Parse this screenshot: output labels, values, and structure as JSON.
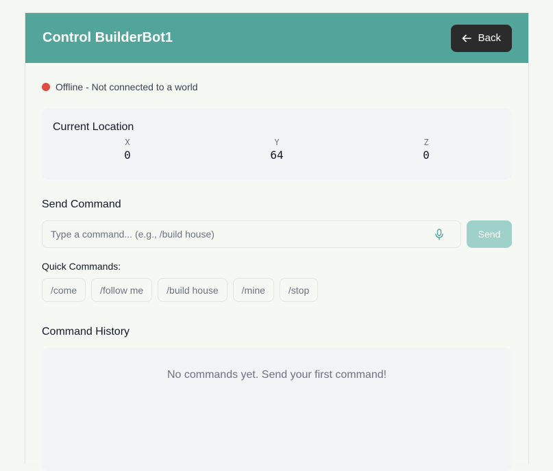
{
  "header": {
    "title": "Control BuilderBot1",
    "back_label": "Back"
  },
  "status": {
    "text": "Offline - Not connected to a world",
    "color": "#e04e41"
  },
  "location": {
    "title": "Current Location",
    "x_label": "X",
    "x_value": "0",
    "y_label": "Y",
    "y_value": "64",
    "z_label": "Z",
    "z_value": "0"
  },
  "command": {
    "title": "Send Command",
    "placeholder": "Type a command... (e.g., /build house)",
    "value": "",
    "send_label": "Send",
    "mic_icon": "microphone-icon"
  },
  "quick": {
    "title": "Quick Commands:",
    "items": [
      "/come",
      "/follow me",
      "/build house",
      "/mine",
      "/stop"
    ]
  },
  "history": {
    "title": "Command History",
    "empty_text": "No commands yet. Send your first command!"
  },
  "colors": {
    "header": "#52a59b",
    "back_button": "#2b2b2b",
    "send_button": "#9dd1c9",
    "background": "#f5f7f2"
  }
}
